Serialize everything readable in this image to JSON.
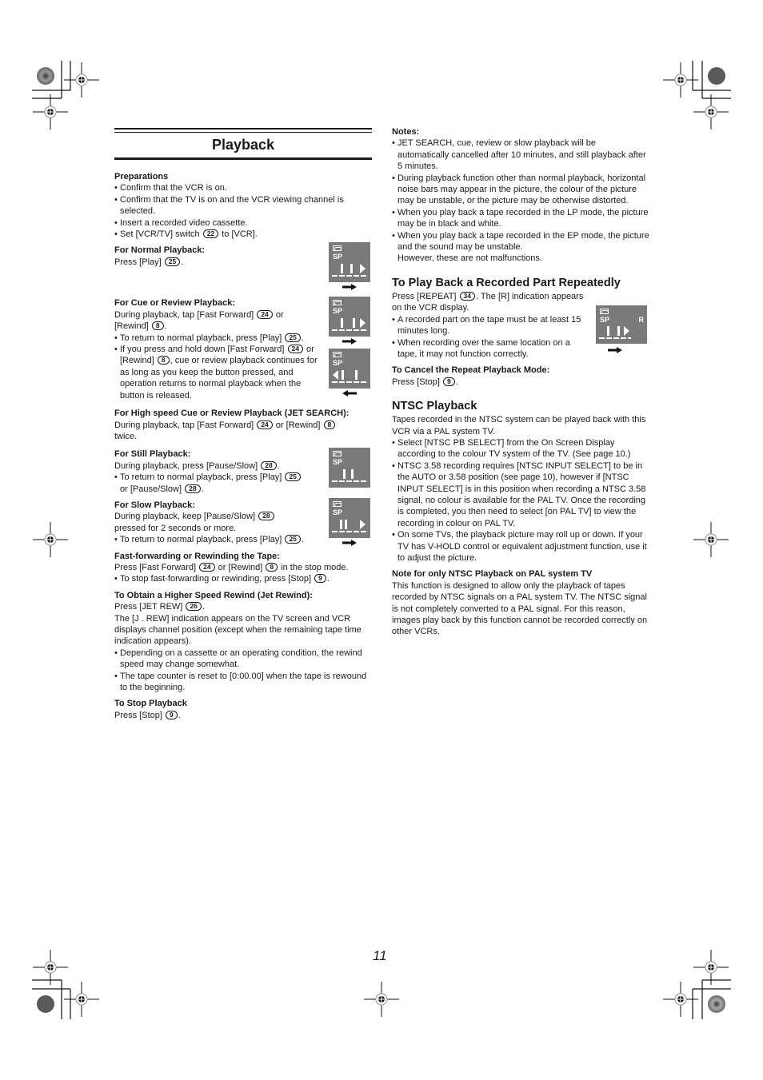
{
  "page": {
    "title": "Playback",
    "page_number": "11"
  },
  "left": {
    "preparations": {
      "heading": "Preparations",
      "items": [
        "Confirm that the VCR is on.",
        "Confirm that the TV is on and the VCR viewing channel is selected.",
        "Insert a recorded video cassette."
      ],
      "last_item": {
        "pre": "Set [VCR/TV] switch",
        "btn": "22",
        "post": "to [VCR]."
      }
    },
    "normal": {
      "heading": "For Normal Playback:",
      "text_pre": "Press [Play]",
      "btn": "25",
      "text_post": "."
    },
    "cue": {
      "heading": "For Cue or Review Playback:",
      "line1_pre": "During playback, tap [Fast Forward]",
      "line1_btn": "24",
      "line1_mid": "or",
      "line2_pre": "[Rewind]",
      "line2_btn": "8",
      "line2_post": ".",
      "bullet1_pre": "To return to normal playback, press [Play]",
      "bullet1_btn": "25",
      "bullet1_post": ".",
      "bullet2_pre": "If you press and hold down [Fast Forward]",
      "bullet2_btn1": "24",
      "bullet2_mid": "or [Rewind]",
      "bullet2_btn2": "8",
      "bullet2_post": ", cue or review playback continues for as long as you keep the button pressed, and operation returns to normal playback when the button is released."
    },
    "jet_search": {
      "heading": "For High speed Cue or Review Playback (JET SEARCH):",
      "pre": "During playback, tap [Fast Forward]",
      "btn1": "24",
      "mid": "or [Rewind]",
      "btn2": "8",
      "post": "twice."
    },
    "still": {
      "heading": "For Still Playback:",
      "pre": "During playback, press [Pause/Slow]",
      "btn": "28",
      "post": ".",
      "bullet_pre": "To return to normal playback, press [Play]",
      "bullet_btn1": "25",
      "bullet_mid": "or [Pause/Slow]",
      "bullet_btn2": "28",
      "bullet_post": "."
    },
    "slow": {
      "heading": "For Slow Playback:",
      "pre": "During playback, keep [Pause/Slow]",
      "btn": "28",
      "line2": "pressed for 2 seconds or more.",
      "bullet_pre": "To return to normal playback, press [Play]",
      "bullet_btn": "25",
      "bullet_post": "."
    },
    "ff_rew": {
      "heading": "Fast-forwarding or Rewinding the Tape:",
      "pre": "Press [Fast Forward]",
      "btn1": "24",
      "mid": "or [Rewind]",
      "btn2": "8",
      "post": "in the stop mode.",
      "bullet_pre": "To stop fast-forwarding or rewinding, press [Stop]",
      "bullet_btn": "9",
      "bullet_post": "."
    },
    "jet_rewind": {
      "heading": "To Obtain a Higher Speed Rewind (Jet Rewind):",
      "pre": "Press [JET REW]",
      "btn": "26",
      "post": ".",
      "para": "The [J . REW] indication appears on the TV screen and VCR displays channel position (except when the remaining tape time indication appears).",
      "bullets": [
        "Depending on a cassette or an operating condition, the rewind speed may change somewhat.",
        "The tape counter is reset to [0:00.00] when the tape is rewound to the beginning."
      ]
    },
    "stop": {
      "heading": "To Stop Playback",
      "pre": "Press [Stop]",
      "btn": "9",
      "post": "."
    }
  },
  "right": {
    "notes": {
      "heading": "Notes:",
      "items": [
        "JET SEARCH, cue, review or slow playback will be automatically cancelled after 10 minutes, and still playback after 5 minutes.",
        "During playback function other than normal playback, horizontal noise bars may appear in the picture, the colour of the picture may be unstable, or the picture may be otherwise distorted.",
        "When you play back a tape recorded in the LP mode, the picture may be in black and white.",
        "When you play back a tape recorded in the EP mode, the picture and the sound may be unstable."
      ],
      "trailer": "However, these are not malfunctions."
    },
    "repeat": {
      "heading": "To Play Back a Recorded Part Repeatedly",
      "pre": "Press [REPEAT]",
      "btn": "34",
      "post": ". The [R] indication appears on the VCR display.",
      "bullets": [
        "A recorded part on the tape must be at least 15 minutes long.",
        "When recording over the same location on a tape, it may not function correctly."
      ],
      "cancel_heading": "To Cancel the Repeat Playback Mode:",
      "cancel_pre": "Press [Stop]",
      "cancel_btn": "9",
      "cancel_post": "."
    },
    "ntsc": {
      "heading": "NTSC Playback",
      "intro": "Tapes recorded in the NTSC system can be played back with this VCR via a PAL system TV.",
      "bullets": [
        "Select [NTSC PB SELECT] from the On Screen Display according to the colour TV system of the TV. (See page 10.)",
        "NTSC 3.58 recording requires [NTSC INPUT SELECT] to be in the AUTO or 3.58 position (see page 10), however if [NTSC INPUT SELECT] is in this position when recording a NTSC 3.58 signal, no colour is available for the PAL TV. Once the recording is completed, you then need to select [on PAL TV] to view the recording in colour on PAL TV.",
        "On some TVs, the playback picture may roll up or down. If your TV has V-HOLD control or equivalent adjustment function, use it to adjust the picture."
      ],
      "note_heading": "Note for only NTSC Playback on PAL system TV",
      "note_body": "This function is designed to allow only the playback of tapes recorded by NTSC signals on a PAL system TV. The NTSC signal is not completely converted to a PAL signal. For this reason, images play back by this function cannot be recorded correctly on other VCRs."
    }
  },
  "osd": {
    "sp_label": "SP",
    "repeat_label": "R",
    "background_color": "#7a7a7a",
    "icons": [
      {
        "name": "normal-play",
        "symbol": "cassette-icon",
        "arrow": "right"
      },
      {
        "name": "cue",
        "symbol": "cassette-icon",
        "arrow": "right"
      },
      {
        "name": "review",
        "symbol": "cassette-icon",
        "arrow": "left"
      },
      {
        "name": "still",
        "symbol": "cassette-icon",
        "arrow": "none"
      },
      {
        "name": "slow",
        "symbol": "cassette-icon",
        "arrow": "right"
      },
      {
        "name": "repeat",
        "symbol": "cassette-icon",
        "arrow": "right"
      }
    ]
  }
}
